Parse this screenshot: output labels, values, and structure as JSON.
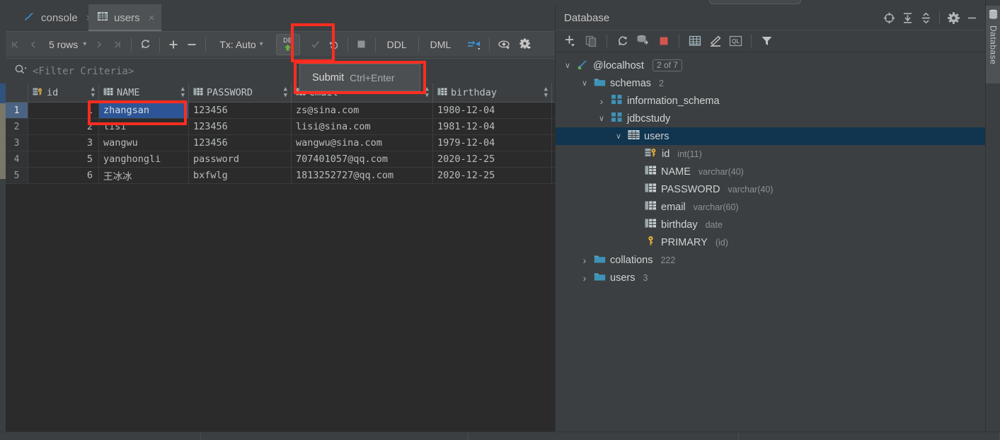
{
  "window": {
    "editor_tabs": [
      {
        "label": "console",
        "icon": "mysql-dolphin-icon",
        "active": false,
        "close": "×"
      },
      {
        "label": "users",
        "icon": "table-icon",
        "active": true,
        "close": "×"
      }
    ]
  },
  "grid_toolbar": {
    "first_page": "⧏|",
    "prev_page": "‹",
    "rows_label": "5 rows",
    "rows_caret": "▾",
    "next_page": "›",
    "last_page": "|⧐",
    "reload_icon": "refresh-icon",
    "add_row": "+",
    "remove_row": "−",
    "tx_label": "Tx: Auto",
    "tx_caret": "▾",
    "submit_db_label": "DB",
    "submit_arrow": "↑",
    "rollback_icon": "rollback-icon",
    "stop_icon": "stop-icon",
    "ddl_label": "DDL",
    "dml_label": "DML",
    "transpose_icon": "transpose-icon",
    "view_icon": "eye-icon",
    "settings_icon": "gear-icon"
  },
  "tooltip": {
    "title": "Submit",
    "shortcut": "Ctrl+Enter"
  },
  "filter": {
    "icon": "search-icon",
    "placeholder": "<Filter Criteria>"
  },
  "table": {
    "columns": [
      {
        "key": "id",
        "label": "id",
        "icon": "primary-key-icon"
      },
      {
        "key": "name",
        "label": "NAME",
        "icon": "column-icon"
      },
      {
        "key": "password",
        "label": "PASSWORD",
        "icon": "column-icon"
      },
      {
        "key": "email",
        "label": "email",
        "icon": "column-icon"
      },
      {
        "key": "birthday",
        "label": "birthday",
        "icon": "column-icon"
      }
    ],
    "rows": [
      {
        "n": "1",
        "id": "1",
        "name": "zhangsan",
        "password": "123456",
        "email": "zs@sina.com",
        "birthday": "1980-12-04"
      },
      {
        "n": "2",
        "id": "2",
        "name": "lisi",
        "password": "123456",
        "email": "lisi@sina.com",
        "birthday": "1981-12-04"
      },
      {
        "n": "3",
        "id": "3",
        "name": "wangwu",
        "password": "123456",
        "email": "wangwu@sina.com",
        "birthday": "1979-12-04"
      },
      {
        "n": "4",
        "id": "5",
        "name": "yanghongli",
        "password": "password",
        "email": "707401057@qq.com",
        "birthday": "2020-12-25"
      },
      {
        "n": "5",
        "id": "6",
        "name": "王冰冰",
        "password": "bxfwlg",
        "email": "1813252727@qq.com",
        "birthday": "2020-12-25"
      }
    ],
    "selected_cell": {
      "row": 0,
      "column": "name"
    }
  },
  "database_panel": {
    "title": "Database",
    "header_buttons": [
      {
        "name": "locate-icon",
        "glyph": "⊕"
      },
      {
        "name": "expand-all-icon",
        "glyph": "↧"
      },
      {
        "name": "collapse-all-icon",
        "glyph": "↥"
      },
      {
        "name": "settings-icon",
        "glyph": "⚙"
      },
      {
        "name": "hide-icon",
        "glyph": "−"
      }
    ],
    "toolbar_buttons": [
      {
        "name": "add-data-source-icon",
        "glyph": "+"
      },
      {
        "name": "duplicate-icon",
        "glyph": "⧉"
      },
      {
        "name": "refresh-icon",
        "glyph": "⟳"
      },
      {
        "name": "sync-schema-icon",
        "glyph": "⛁"
      },
      {
        "name": "stop-icon",
        "glyph": "■"
      },
      {
        "name": "open-table-icon",
        "glyph": "☷"
      },
      {
        "name": "modify-table-icon",
        "glyph": "╱"
      },
      {
        "name": "query-console-icon",
        "glyph": "QL"
      },
      {
        "name": "filter-icon",
        "glyph": "▼"
      }
    ],
    "tree": [
      {
        "depth": 0,
        "twist": "∨",
        "icon": "mysql-dolphin-icon",
        "label": "@localhost",
        "badge": "2 of 7",
        "meta": "",
        "selected": false
      },
      {
        "depth": 1,
        "twist": "∨",
        "icon": "folder-icon",
        "label": "schemas",
        "badge": "",
        "meta": "2",
        "selected": false
      },
      {
        "depth": 2,
        "twist": "›",
        "icon": "schema-icon",
        "label": "information_schema",
        "badge": "",
        "meta": "",
        "selected": false
      },
      {
        "depth": 2,
        "twist": "∨",
        "icon": "schema-icon",
        "label": "jdbcstudy",
        "badge": "",
        "meta": "",
        "selected": false
      },
      {
        "depth": 3,
        "twist": "∨",
        "icon": "table-icon",
        "label": "users",
        "badge": "",
        "meta": "",
        "selected": true
      },
      {
        "depth": 4,
        "twist": "",
        "icon": "primary-key-icon",
        "label": "id",
        "badge": "",
        "meta": "int(11)",
        "selected": false
      },
      {
        "depth": 4,
        "twist": "",
        "icon": "column-icon",
        "label": "NAME",
        "badge": "",
        "meta": "varchar(40)",
        "selected": false
      },
      {
        "depth": 4,
        "twist": "",
        "icon": "column-icon",
        "label": "PASSWORD",
        "badge": "",
        "meta": "varchar(40)",
        "selected": false
      },
      {
        "depth": 4,
        "twist": "",
        "icon": "column-icon",
        "label": "email",
        "badge": "",
        "meta": "varchar(60)",
        "selected": false
      },
      {
        "depth": 4,
        "twist": "",
        "icon": "column-icon",
        "label": "birthday",
        "badge": "",
        "meta": "date",
        "selected": false
      },
      {
        "depth": 4,
        "twist": "",
        "icon": "key-icon",
        "label": "PRIMARY",
        "badge": "",
        "meta": "(id)",
        "selected": false
      },
      {
        "depth": 1,
        "twist": "›",
        "icon": "folder-icon",
        "label": "collations",
        "badge": "",
        "meta": "222",
        "selected": false
      },
      {
        "depth": 1,
        "twist": "›",
        "icon": "folder-icon",
        "label": "users",
        "badge": "",
        "meta": "3",
        "selected": false
      }
    ]
  },
  "right_strip": {
    "label": "Database",
    "icon": "database-icon"
  },
  "colors": {
    "annotation": "#ff2d20",
    "selection_blue": "#2d5596",
    "tree_selection": "#11344f",
    "accent_blue": "#3d93d8",
    "green_arrow": "#62b543",
    "panel_bg": "#3c3f41",
    "grid_bg": "#2b2b2b"
  }
}
